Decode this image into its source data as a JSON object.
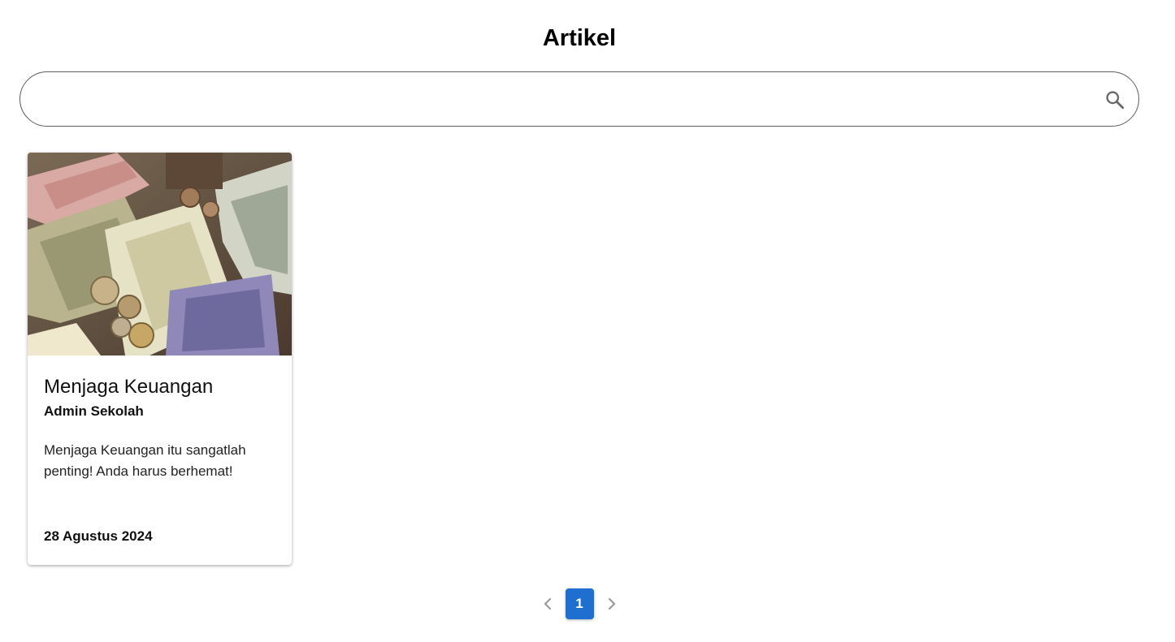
{
  "header": {
    "title": "Artikel"
  },
  "search": {
    "value": "",
    "placeholder": "",
    "icon": "search-icon"
  },
  "articles": [
    {
      "image_icon": "money-photo",
      "title": "Menjaga Keuangan",
      "author": "Admin Sekolah",
      "excerpt": "Menjaga Keuangan itu sangatlah penting! Anda harus berhemat!",
      "date": "28 Agustus 2024"
    }
  ],
  "pagination": {
    "prev_icon": "chevron-left-icon",
    "current_page": "1",
    "next_icon": "chevron-right-icon",
    "active_color": "#1e6fd0"
  }
}
